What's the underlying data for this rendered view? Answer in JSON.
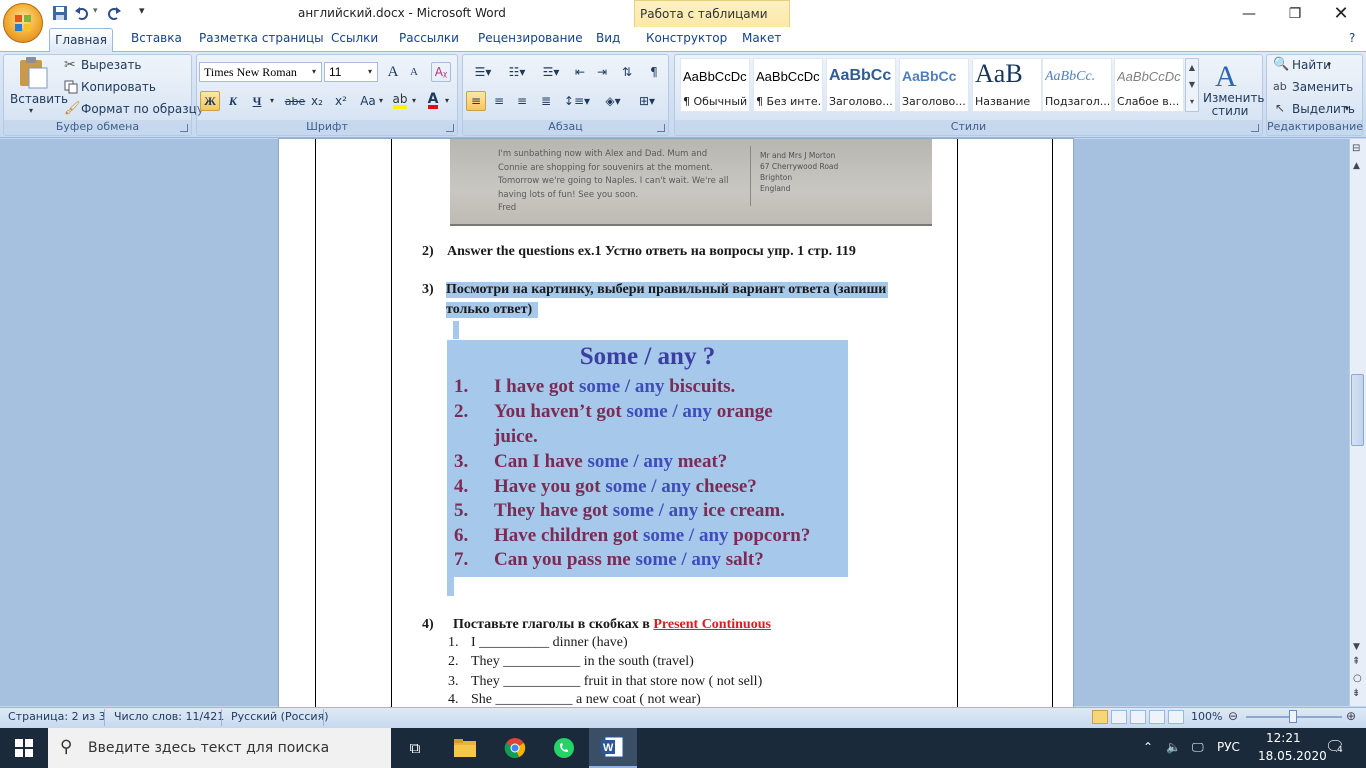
{
  "window": {
    "title": "английский.docx - Microsoft Word",
    "context_tab_title": "Работа с таблицами"
  },
  "ribbon_tabs": [
    "Главная",
    "Вставка",
    "Разметка страницы",
    "Ссылки",
    "Рассылки",
    "Рецензирование",
    "Вид",
    "Конструктор",
    "Макет"
  ],
  "clipboard": {
    "paste": "Вставить",
    "cut": "Вырезать",
    "copy": "Копировать",
    "format_painter": "Формат по образцу",
    "label": "Буфер обмена"
  },
  "font": {
    "name": "Times New Roman",
    "size": "11",
    "label": "Шрифт",
    "bold": "Ж",
    "italic": "К",
    "underline": "Ч",
    "strike": "abe",
    "subscript": "x₂",
    "superscript": "x²",
    "case": "Aa",
    "grow": "A",
    "shrink": "A"
  },
  "paragraph": {
    "label": "Абзац"
  },
  "styles": {
    "label": "Стили",
    "items": [
      {
        "sample": "AaBbCcDc",
        "name": "¶ Обычный"
      },
      {
        "sample": "AaBbCcDc",
        "name": "¶ Без инте..."
      },
      {
        "sample": "AaBbCc",
        "name": "Заголово..."
      },
      {
        "sample": "AaBbCc",
        "name": "Заголово..."
      },
      {
        "sample": "AaB",
        "name": "Название"
      },
      {
        "sample": "AaBbCc.",
        "name": "Подзагол..."
      },
      {
        "sample": "AaBbCcDc",
        "name": "Слабое в..."
      }
    ],
    "change_styles": "Изменить стили"
  },
  "editing": {
    "label": "Редактирование",
    "find": "Найти",
    "replace": "Заменить",
    "select": "Выделить"
  },
  "document": {
    "photo_text": "I'm sunbathing now with Alex and Dad. Mum and\nConnie are shopping for souvenirs at the moment.\nTomorrow we're going to Naples. I can't wait. We're all\nhaving lots of fun! See you soon.\nFred",
    "photo_address": "Mr and Mrs J Morton\n67 Cherrywood Road\nBrighton\nEngland",
    "item2_num": "2)",
    "item2_text": "Answer the questions ex.1 Устно ответь на вопросы упр. 1 стр. 119",
    "item3_num": "3)",
    "item3_line1": "Посмотри на картинку, выбери правильный вариант ответа (запиши",
    "item3_line2": "только ответ)",
    "quiz": {
      "title": "Some / any ?",
      "items": [
        {
          "num": "1.",
          "pre": "I have got ",
          "opt": "some / any",
          "post": " biscuits."
        },
        {
          "num": "2.",
          "pre": "You haven’t got ",
          "opt": "some / any",
          "post": " orange"
        },
        {
          "num": "",
          "pre": "juice.",
          "opt": "",
          "post": ""
        },
        {
          "num": "3.",
          "pre": "Can I have ",
          "opt": "some / any",
          "post": " meat?"
        },
        {
          "num": "4.",
          "pre": "Have you got ",
          "opt": "some / any",
          "post": " cheese?"
        },
        {
          "num": "5.",
          "pre": "They have got ",
          "opt": "some / any",
          "post": " ice cream."
        },
        {
          "num": "6.",
          "pre": "Have children got ",
          "opt": "some / any",
          "post": " popcorn?"
        },
        {
          "num": "7.",
          "pre": "Can you pass me ",
          "opt": "some / any",
          "post": " salt?"
        }
      ]
    },
    "item4_num": "4)",
    "item4_text": "Поставьте глаголы в скобках в ",
    "item4_link": "Present Continuous",
    "exercises": [
      {
        "num": "1.",
        "text": "I __________ dinner (have)"
      },
      {
        "num": "2.",
        "text": "They ___________ in the south (travel)"
      },
      {
        "num": "3.",
        "text": "They ___________ fruit in that store now ( not sell)"
      },
      {
        "num": "4.",
        "text": "She ___________ a new coat ( not wear)"
      }
    ]
  },
  "status": {
    "page": "Страница: 2 из 3",
    "words": "Число слов: 11/421",
    "language": "Русский (Россия)",
    "zoom": "100%"
  },
  "taskbar": {
    "search_placeholder": "Введите здесь текст для поиска",
    "lang": "РУС",
    "time": "12:21",
    "date": "18.05.2020",
    "notifications": "4"
  }
}
